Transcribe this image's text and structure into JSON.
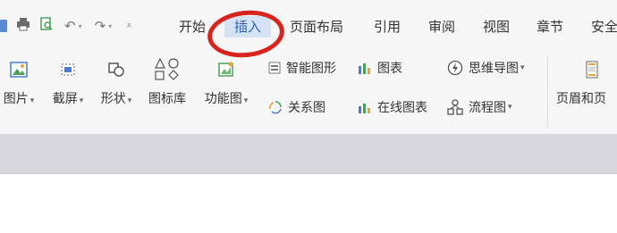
{
  "tabs": [
    {
      "label": "开始"
    },
    {
      "label": "插入"
    },
    {
      "label": "页面布局"
    },
    {
      "label": "引用"
    },
    {
      "label": "审阅"
    },
    {
      "label": "视图"
    },
    {
      "label": "章节"
    },
    {
      "label": "安全"
    }
  ],
  "active_tab": "插入",
  "toolbar": {
    "picture": "图片",
    "screenshot": "截屏",
    "shape": "形状",
    "icon_library": "图标库",
    "function_chart": "功能图",
    "smart_shape": "智能图形",
    "chart": "图表",
    "mind_map": "思维导图",
    "relation_chart": "关系图",
    "online_chart": "在线图表",
    "flowchart": "流程图",
    "header_footer": "页眉和页"
  },
  "colors": {
    "accent": "#2c63b5",
    "tab_highlight": "#d5e2f3",
    "annotation": "#d8231e"
  }
}
